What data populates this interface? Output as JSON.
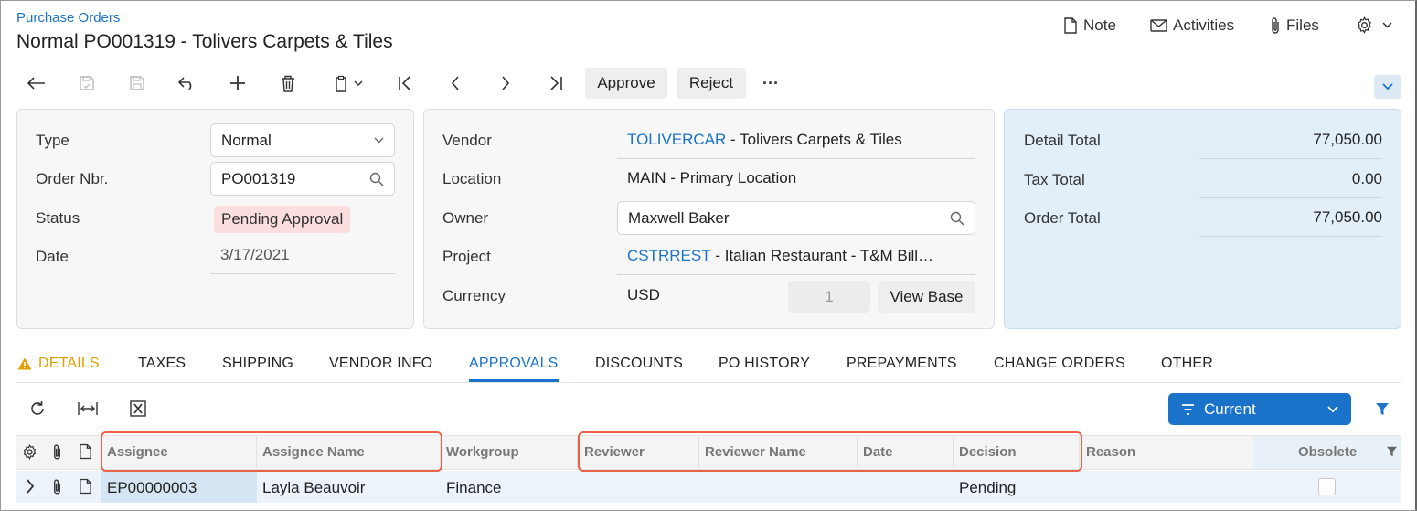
{
  "header": {
    "breadcrumb": "Purchase Orders",
    "title": "Normal PO001319 - Tolivers Carpets & Tiles",
    "note_label": "Note",
    "activities_label": "Activities",
    "files_label": "Files"
  },
  "toolbar": {
    "approve_label": "Approve",
    "reject_label": "Reject",
    "more_label": "···"
  },
  "summary": {
    "type_label": "Type",
    "type_value": "Normal",
    "order_nbr_label": "Order Nbr.",
    "order_nbr_value": "PO001319",
    "status_label": "Status",
    "status_value": "Pending Approval",
    "date_label": "Date",
    "date_value": "3/17/2021"
  },
  "vendor": {
    "vendor_label": "Vendor",
    "vendor_code": "TOLIVERCAR",
    "vendor_name": " - Tolivers Carpets & Tiles",
    "location_label": "Location",
    "location_value": "MAIN - Primary Location",
    "owner_label": "Owner",
    "owner_value": "Maxwell Baker",
    "project_label": "Project",
    "project_code": "CSTRREST",
    "project_name": " - Italian Restaurant - T&M Bill…",
    "currency_label": "Currency",
    "currency_value": "USD",
    "rate_value": "1",
    "view_base_label": "View Base"
  },
  "totals": {
    "detail_total_label": "Detail Total",
    "detail_total_value": "77,050.00",
    "tax_total_label": "Tax Total",
    "tax_total_value": "0.00",
    "order_total_label": "Order Total",
    "order_total_value": "77,050.00"
  },
  "tabs": [
    "DETAILS",
    "TAXES",
    "SHIPPING",
    "VENDOR INFO",
    "APPROVALS",
    "DISCOUNTS",
    "PO HISTORY",
    "PREPAYMENTS",
    "CHANGE ORDERS",
    "OTHER"
  ],
  "active_tab": "APPROVALS",
  "grid": {
    "filter_label": "Current",
    "columns": [
      "Assignee",
      "Assignee Name",
      "Workgroup",
      "Reviewer",
      "Reviewer Name",
      "Date",
      "Decision",
      "Reason",
      "Obsolete"
    ],
    "rows": [
      {
        "assignee": "EP00000003",
        "assignee_name": "Layla Beauvoir",
        "workgroup": "Finance",
        "reviewer": "",
        "reviewer_name": "",
        "date": "",
        "decision": "Pending",
        "reason": "",
        "obsolete": false
      }
    ]
  },
  "colors": {
    "accent": "#1a73c8",
    "warning": "#e1a000",
    "status_badge_bg": "#fbdede",
    "highlight_border": "#e8634a",
    "totals_panel_bg": "#e2eef8"
  }
}
